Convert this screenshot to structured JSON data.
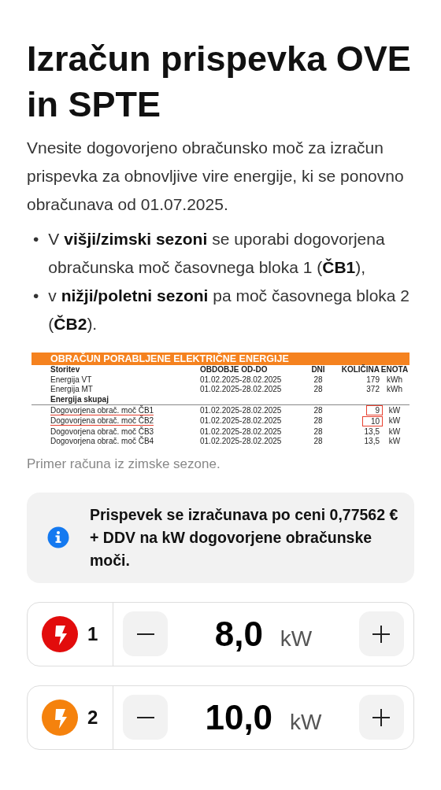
{
  "title": "Izračun prispevka OVE in SPTE",
  "intro": "Vnesite dogovorjeno obračunsko moč za izračun prispevka za obnovljive vire energije, ki se ponovno obračunava od 01.07.2025.",
  "bullets": [
    {
      "marker": "•",
      "text": "V **višji/zimski sezoni** se uporabi dogovorjena obračunska moč časovnega bloka 1 (**ČB1**),"
    },
    {
      "marker": "•",
      "text": "v **nižji/poletni sezoni** pa moč časovnega bloka 2 (**ČB2**)."
    }
  ],
  "bill": {
    "heading": "OBRAČUN PORABLJENE ELEKTRIČNE ENERGIJE",
    "columns": [
      "Storitev",
      "OBDOBJE OD-DO",
      "DNI",
      "KOLIČINA",
      "ENOTA"
    ],
    "rows": [
      {
        "kind": "item",
        "cells": [
          "Energija VT",
          "01.02.2025-28.02.2025",
          "28",
          "179",
          "kWh"
        ],
        "marked": false
      },
      {
        "kind": "item",
        "cells": [
          "Energija MT",
          "01.02.2025-28.02.2025",
          "28",
          "372",
          "kWh"
        ],
        "marked": false
      },
      {
        "kind": "section",
        "cells": [
          "Energija skupaj"
        ],
        "marked": false
      },
      {
        "kind": "item",
        "cells": [
          "Dogovorjena obrač. moč ČB1",
          "01.02.2025-28.02.2025",
          "28",
          "9",
          "kW"
        ],
        "marked": true
      },
      {
        "kind": "item",
        "cells": [
          "Dogovorjena obrač. moč ČB2",
          "01.02.2025-28.02.2025",
          "28",
          "10",
          "kW"
        ],
        "marked": true
      },
      {
        "kind": "item",
        "cells": [
          "Dogovorjena obrač. moč ČB3",
          "01.02.2025-28.02.2025",
          "28",
          "13,5",
          "kW"
        ],
        "marked": false
      },
      {
        "kind": "item",
        "cells": [
          "Dogovorjena obrač. moč ČB4",
          "01.02.2025-28.02.2025",
          "28",
          "13,5",
          "kW"
        ],
        "marked": false
      }
    ]
  },
  "caption": "Primer računa iz zimske sezone.",
  "note": "Prispevek se izračunava po ceni 0,77562 € + DDV na kW dogovorjene obračunske moči.",
  "blocks": [
    {
      "number": "1",
      "color": "#e20c0c",
      "value": "8,0",
      "unit": "kW"
    },
    {
      "number": "2",
      "color": "#f5820d",
      "value": "10,0",
      "unit": "kW"
    }
  ]
}
